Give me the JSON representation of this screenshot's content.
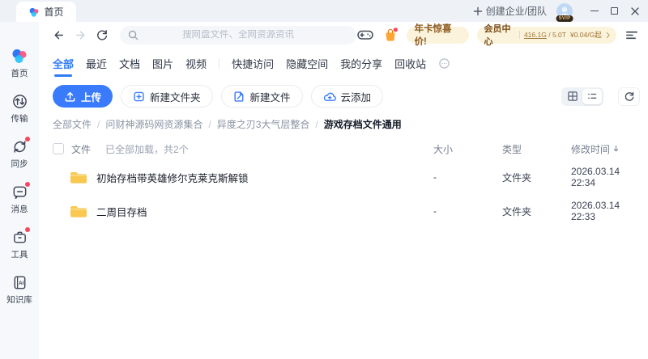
{
  "titlebar": {
    "tab_label": "首页",
    "create_team_label": "创建企业/团队",
    "avatar_badge": "SVIP"
  },
  "toolbar": {
    "search_placeholder": "搜网盘文件、全网资源资讯",
    "promo_label": "年卡惊喜价!",
    "member_center_label": "会员中心",
    "storage_used": "416.1G",
    "storage_separator": "/",
    "storage_total": "5.0T",
    "price_label": "¥0.04/G起"
  },
  "sidebar": {
    "items": [
      {
        "label": "首页"
      },
      {
        "label": "传输"
      },
      {
        "label": "同步"
      },
      {
        "label": "消息"
      },
      {
        "label": "工具"
      },
      {
        "label": "知识库"
      }
    ]
  },
  "tabs": [
    "全部",
    "最近",
    "文档",
    "图片",
    "视频",
    "快捷访问",
    "隐藏空间",
    "我的分享",
    "回收站"
  ],
  "actions": [
    "上传",
    "新建文件夹",
    "新建文件",
    "云添加"
  ],
  "breadcrumb": {
    "separator": "/",
    "items": [
      "全部文件",
      "问财神源码网资源集合",
      "异度之刃3大气层整合",
      "游戏存档文件通用"
    ]
  },
  "file_list": {
    "select_all_label": "文件",
    "load_status": "已全部加载，共2个",
    "columns": {
      "size": "大小",
      "type": "类型",
      "modified": "修改时间"
    },
    "rows": [
      {
        "name": "初始存档带英雄修尔克莱克斯解锁",
        "size": "-",
        "type": "文件夹",
        "modified": "2026.03.14 22:34"
      },
      {
        "name": "二周目存档",
        "size": "-",
        "type": "文件夹",
        "modified": "2026.03.14 22:33"
      }
    ]
  },
  "colors": {
    "accent_blue": "#2e7bf7",
    "promo_bg": "#fcf3dd",
    "promo_text": "#8a591e",
    "folder_yellow": "#f8c850",
    "notification_red": "#f8465c"
  }
}
